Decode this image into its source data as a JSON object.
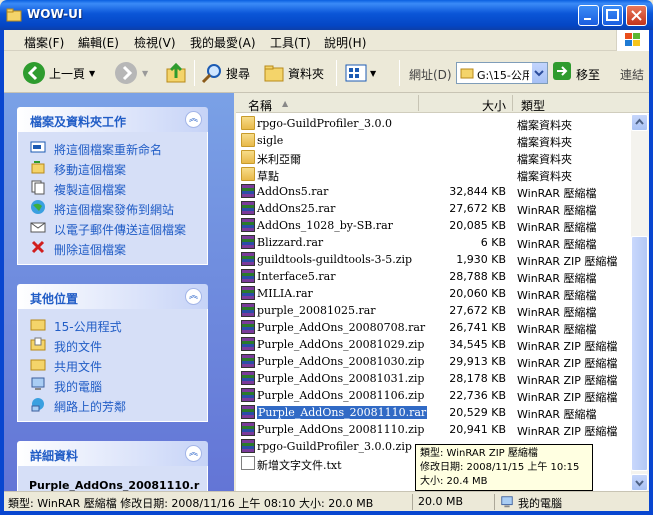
{
  "window": {
    "title": "WOW-UI"
  },
  "menu": [
    "檔案(F)",
    "編輯(E)",
    "檢視(V)",
    "我的最愛(A)",
    "工具(T)",
    "說明(H)"
  ],
  "toolbar": {
    "back": "上一頁",
    "search": "搜尋",
    "folders": "資料夾",
    "address_label": "網址(D)",
    "address_value": "G:\\15-公用",
    "go": "移至",
    "links": "連結"
  },
  "tasks_panel": {
    "title": "檔案及資料夾工作",
    "items": [
      "將這個檔案重新命名",
      "移動這個檔案",
      "複製這個檔案",
      "將這個檔案發佈到網站",
      "以電子郵件傳送這個檔案",
      "刪除這個檔案"
    ]
  },
  "places_panel": {
    "title": "其他位置",
    "items": [
      "15-公用程式",
      "我的文件",
      "共用文件",
      "我的電腦",
      "網路上的芳鄰"
    ]
  },
  "details_panel": {
    "title": "詳細資料",
    "filename": "Purple_AddOns_20081110.r"
  },
  "columns": {
    "name": "名稱",
    "size": "大小",
    "type": "類型"
  },
  "files": [
    {
      "name": "rpgo-GuildProfiler_3.0.0",
      "size": "",
      "type": "檔案資料夾",
      "kind": "folder"
    },
    {
      "name": "sigle",
      "size": "",
      "type": "檔案資料夾",
      "kind": "folder"
    },
    {
      "name": "米利亞爾",
      "size": "",
      "type": "檔案資料夾",
      "kind": "folder"
    },
    {
      "name": "草點",
      "size": "",
      "type": "檔案資料夾",
      "kind": "folder"
    },
    {
      "name": "AddOns5.rar",
      "size": "32,844 KB",
      "type": "WinRAR 壓縮檔",
      "kind": "rar"
    },
    {
      "name": "AddOns25.rar",
      "size": "27,672 KB",
      "type": "WinRAR 壓縮檔",
      "kind": "rar"
    },
    {
      "name": "AddOns_1028_by-SB.rar",
      "size": "20,085 KB",
      "type": "WinRAR 壓縮檔",
      "kind": "rar"
    },
    {
      "name": "Blizzard.rar",
      "size": "6 KB",
      "type": "WinRAR 壓縮檔",
      "kind": "rar"
    },
    {
      "name": "guildtools-guildtools-3-5.zip",
      "size": "1,930 KB",
      "type": "WinRAR ZIP 壓縮檔",
      "kind": "rar"
    },
    {
      "name": "Interface5.rar",
      "size": "28,788 KB",
      "type": "WinRAR 壓縮檔",
      "kind": "rar"
    },
    {
      "name": "MILIA.rar",
      "size": "20,060 KB",
      "type": "WinRAR 壓縮檔",
      "kind": "rar"
    },
    {
      "name": "purple_20081025.rar",
      "size": "27,672 KB",
      "type": "WinRAR 壓縮檔",
      "kind": "rar"
    },
    {
      "name": "Purple_AddOns_20080708.rar",
      "size": "26,741 KB",
      "type": "WinRAR 壓縮檔",
      "kind": "rar"
    },
    {
      "name": "Purple_AddOns_20081029.zip",
      "size": "34,545 KB",
      "type": "WinRAR ZIP 壓縮檔",
      "kind": "rar"
    },
    {
      "name": "Purple_AddOns_20081030.zip",
      "size": "29,913 KB",
      "type": "WinRAR ZIP 壓縮檔",
      "kind": "rar"
    },
    {
      "name": "Purple_AddOns_20081031.zip",
      "size": "28,178 KB",
      "type": "WinRAR ZIP 壓縮檔",
      "kind": "rar"
    },
    {
      "name": "Purple_AddOns_20081106.zip",
      "size": "22,736 KB",
      "type": "WinRAR ZIP 壓縮檔",
      "kind": "rar"
    },
    {
      "name": "Purple_AddOns_20081110.rar",
      "size": "20,529 KB",
      "type": "WinRAR 壓縮檔",
      "kind": "rar",
      "selected": true
    },
    {
      "name": "Purple_AddOns_20081110.zip",
      "size": "20,941 KB",
      "type": "WinRAR ZIP 壓縮檔",
      "kind": "rar"
    },
    {
      "name": "rpgo-GuildProfiler_3.0.0.zip",
      "size": "",
      "type": "",
      "kind": "rar"
    },
    {
      "name": "新增文字文件.txt",
      "size": "",
      "type": "",
      "kind": "txt"
    }
  ],
  "tooltip": {
    "line1": "類型: WinRAR ZIP 壓縮檔",
    "line2": "修改日期: 2008/11/15 上午 10:15",
    "line3": "大小: 20.4 MB"
  },
  "status": {
    "info": "類型: WinRAR 壓縮檔 修改日期: 2008/11/16 上午 08:10 大小: 20.0 MB",
    "size": "20.0 MB",
    "location": "我的電腦"
  }
}
